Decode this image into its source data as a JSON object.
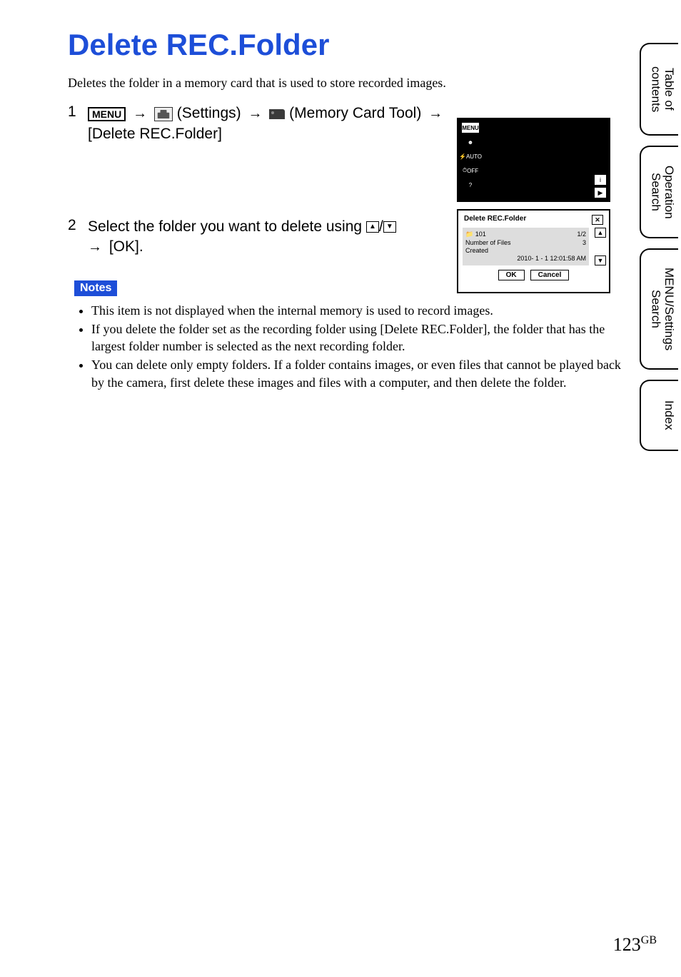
{
  "title": "Delete REC.Folder",
  "intro": "Deletes the folder in a memory card that is used to store recorded images.",
  "step1": {
    "num": "1",
    "menuBadge": "MENU",
    "settingsLabel": "(Settings)",
    "memoryCardLabel": "(Memory Card Tool)",
    "trail": "[Delete REC.Folder]"
  },
  "step2": {
    "num": "2",
    "pre": "Select the folder you want to delete using",
    "post": "[OK]."
  },
  "notesLabel": "Notes",
  "notes": {
    "n0": "This item is not displayed when the internal memory is used to record images.",
    "n1": "If you delete the folder set as the recording folder using [Delete REC.Folder], the folder that has the largest folder number is selected as the next recording folder.",
    "n2": "You can delete only empty folders. If a folder contains images, or even files that cannot be played back by the camera, first delete these images and files with a computer, and then delete the folder."
  },
  "screen1": {
    "menu": "MENU",
    "flash": "AUTO",
    "timer": "OFF",
    "qmark": "?",
    "mode": "i",
    "play": "▶"
  },
  "screen2": {
    "title": "Delete REC.Folder",
    "folder": "101",
    "page": "1/2",
    "filesLabel": "Number of Files",
    "filesValue": "3",
    "createdLabel": "Created",
    "createdValue": "2010- 1 - 1  12:01:58 AM",
    "ok": "OK",
    "cancel": "Cancel"
  },
  "tabs": {
    "toc": "Table of contents",
    "op": "Operation Search",
    "menu": "MENU/Settings Search",
    "index": "Index"
  },
  "pageNumber": "123",
  "pageSuffix": "GB"
}
